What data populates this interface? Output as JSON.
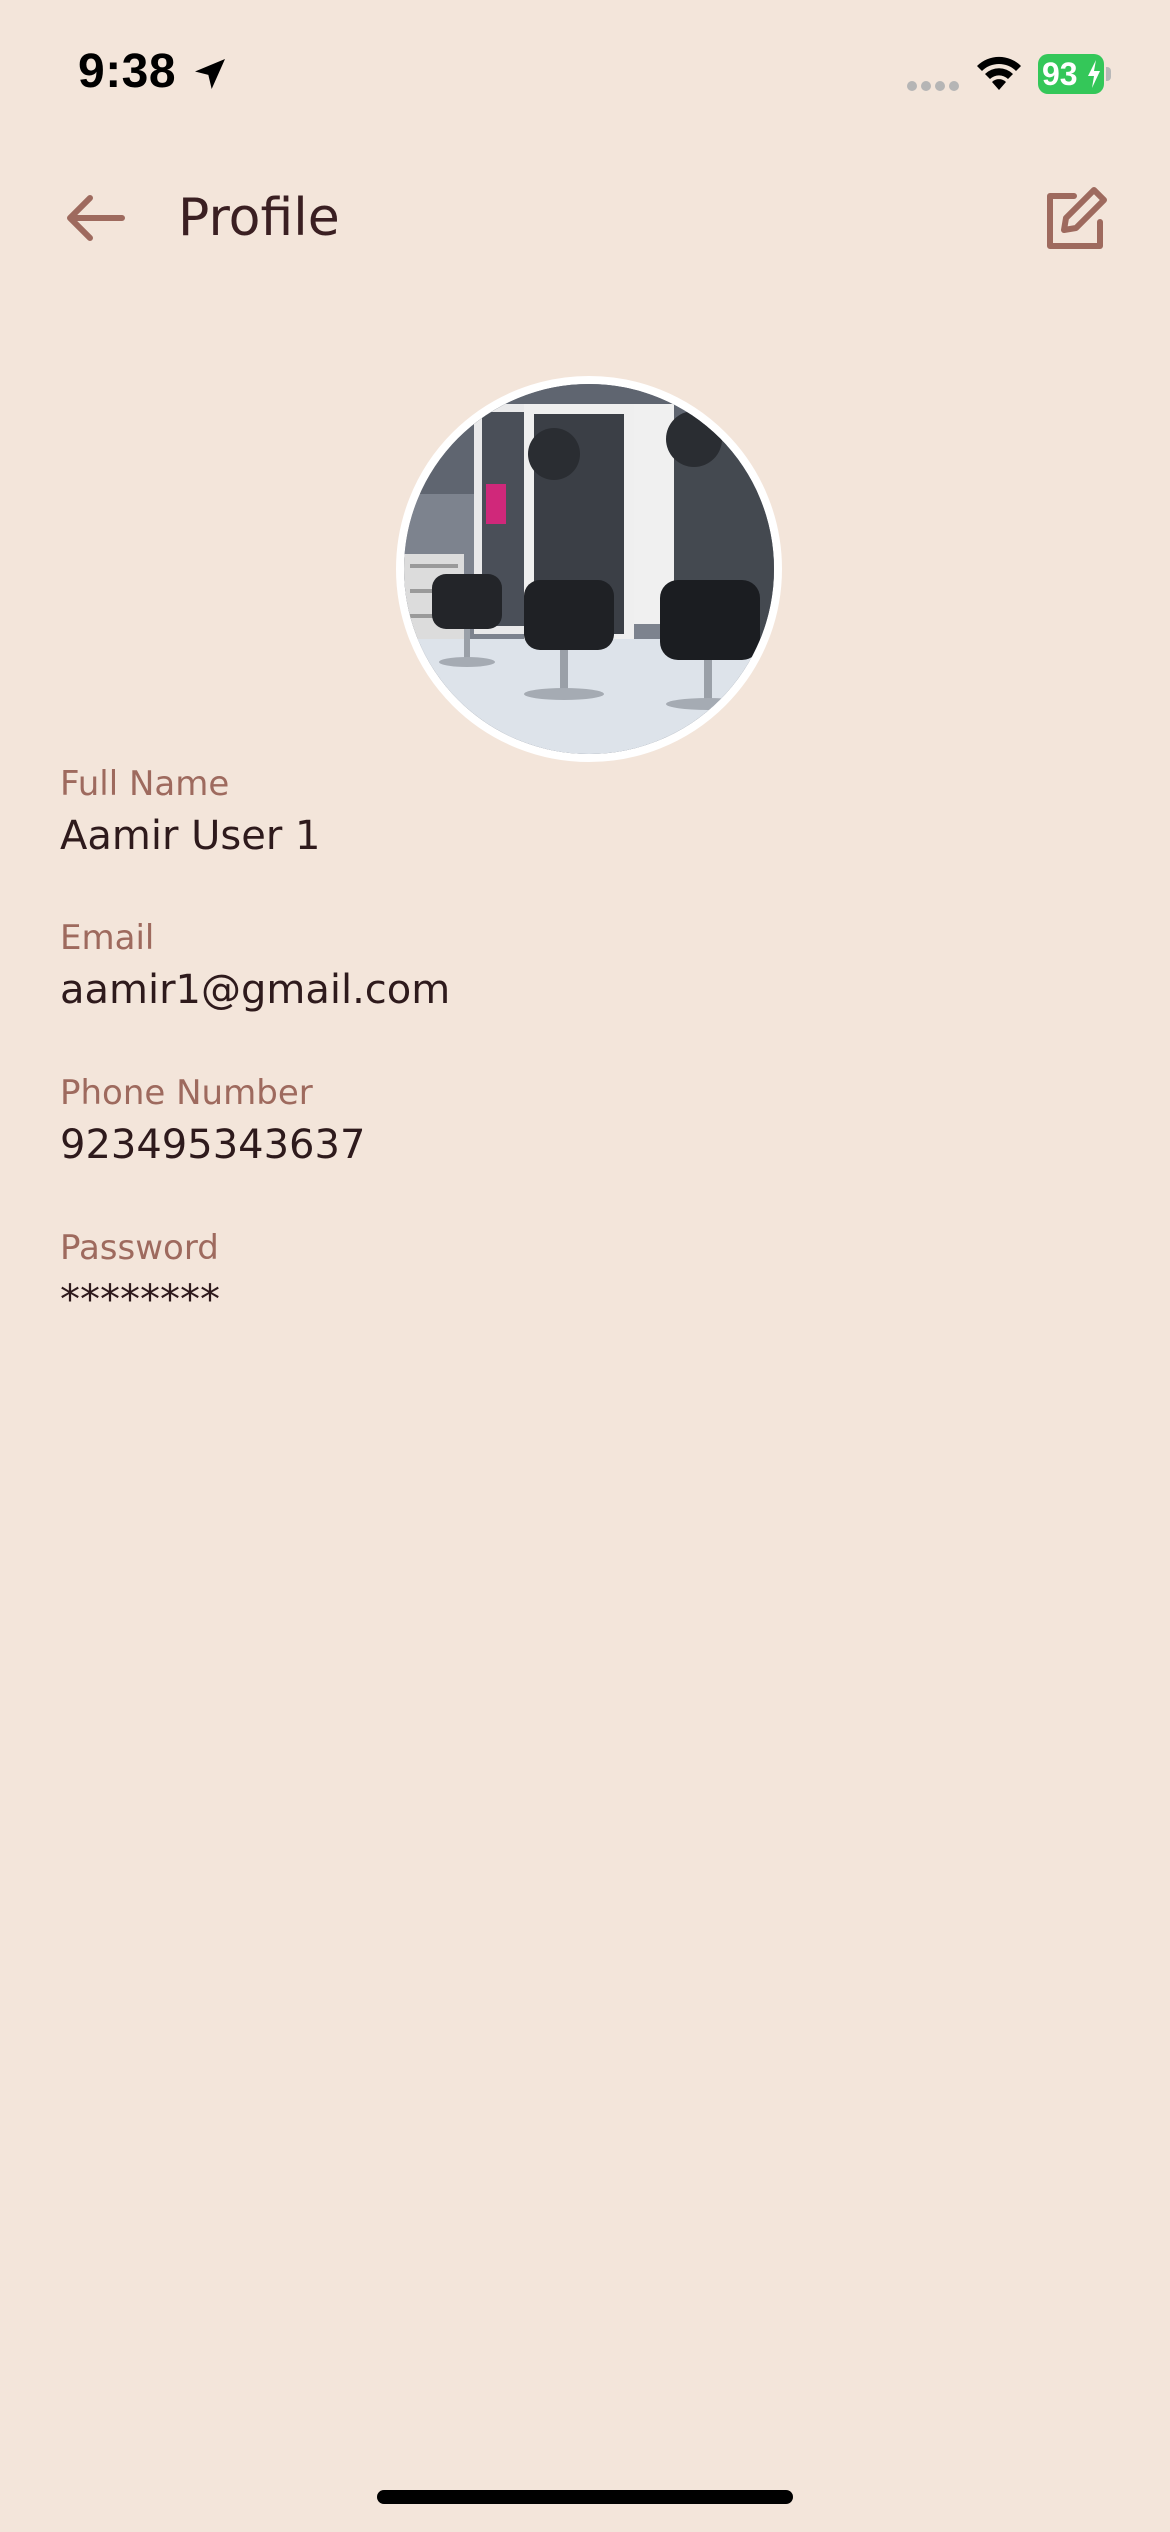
{
  "status_bar": {
    "time": "9:38",
    "battery_level": "93",
    "icons": [
      "location-arrow-icon",
      "cellular-dots-icon",
      "wifi-icon",
      "battery-charging-icon"
    ]
  },
  "header": {
    "title": "Profile",
    "back_icon": "arrow-left-icon",
    "edit_icon": "edit-icon"
  },
  "profile": {
    "avatar_alt": "salon-interior-photo",
    "fields": [
      {
        "label": "Full Name",
        "value": "Aamir User 1"
      },
      {
        "label": "Email",
        "value": "aamir1@gmail.com"
      },
      {
        "label": "Phone Number",
        "value": "923495343637"
      },
      {
        "label": "Password",
        "value": "********"
      }
    ]
  },
  "colors": {
    "background": "#F3E5DA",
    "accent": "#9E6A5E",
    "text_primary": "#2E1A1C",
    "battery_green": "#34C759"
  }
}
